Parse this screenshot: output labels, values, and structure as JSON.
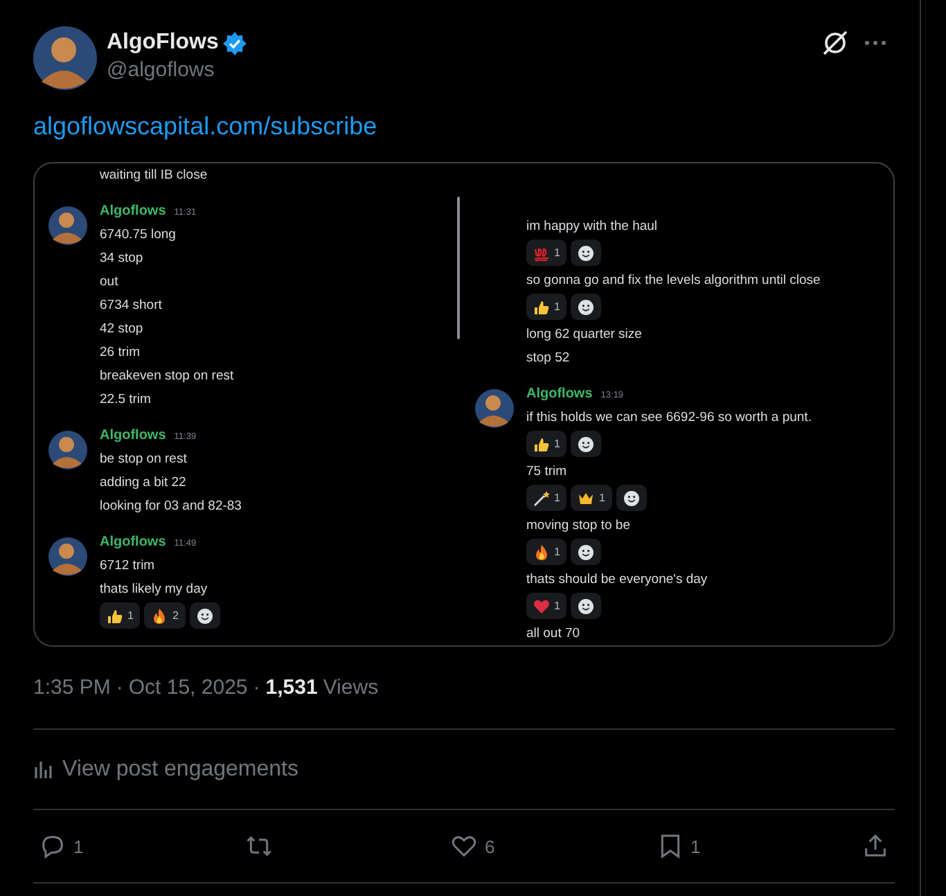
{
  "post": {
    "display_name": "AlgoFlows",
    "verified": true,
    "handle": "@algoflows",
    "link": "algoflowscapital.com/subscribe"
  },
  "chat_columns": [
    {
      "groups": [
        {
          "lines": [
            {
              "text": "waiting till IB close"
            }
          ]
        },
        {
          "author": "Algoflows",
          "time": "11:31",
          "lines": [
            {
              "text": "6740.75 long"
            },
            {
              "text": "34 stop"
            },
            {
              "text": "out"
            },
            {
              "text": "6734 short"
            },
            {
              "text": "42 stop"
            },
            {
              "text": "26 trim"
            },
            {
              "text": "breakeven stop on rest"
            },
            {
              "text": "22.5 trim"
            }
          ]
        },
        {
          "author": "Algoflows",
          "time": "11:39",
          "lines": [
            {
              "text": "be stop on rest"
            },
            {
              "text": "adding a bit 22"
            },
            {
              "text": "looking for 03 and 82-83"
            }
          ]
        },
        {
          "author": "Algoflows",
          "time": "11:49",
          "lines": [
            {
              "text": "6712 trim"
            },
            {
              "text": "thats likely my day",
              "reactions": [
                {
                  "kind": "thumbs_up",
                  "count": "1"
                },
                {
                  "kind": "fire",
                  "count": "2"
                }
              ],
              "add_reaction": true
            }
          ]
        }
      ]
    },
    {
      "groups": [
        {
          "lines": [
            {
              "text": "im happy with the haul",
              "reactions": [
                {
                  "kind": "hundred",
                  "count": "1"
                }
              ],
              "add_reaction": true
            },
            {
              "text": "so gonna go and fix the levels algorithm until close",
              "reactions": [
                {
                  "kind": "thumbs_up",
                  "count": "1"
                }
              ],
              "add_reaction": true
            },
            {
              "text": "long 62 quarter size"
            },
            {
              "text": "stop 52"
            }
          ]
        },
        {
          "author": "Algoflows",
          "time": "13:19",
          "lines": [
            {
              "text": "if this holds we can see 6692-96 so worth a punt.",
              "reactions": [
                {
                  "kind": "thumbs_up",
                  "count": "1"
                }
              ],
              "add_reaction": true
            },
            {
              "text": "75 trim",
              "reactions": [
                {
                  "kind": "wand",
                  "count": "1"
                },
                {
                  "kind": "crown",
                  "count": "1"
                }
              ],
              "add_reaction": true
            },
            {
              "text": "moving stop to be",
              "reactions": [
                {
                  "kind": "fire",
                  "count": "1"
                }
              ],
              "add_reaction": true
            },
            {
              "text": "thats should be everyone's day",
              "reactions": [
                {
                  "kind": "heart",
                  "count": "1"
                }
              ],
              "add_reaction": true
            },
            {
              "text": "all out 70"
            }
          ]
        }
      ]
    }
  ],
  "meta": {
    "time": "1:35 PM",
    "separator_1": "·",
    "date": "Oct 15, 2025",
    "separator_2": "·",
    "views_count": "1,531",
    "views_label": "Views"
  },
  "engagements": "View post engagements",
  "actions": [
    {
      "kind": "reply",
      "count": "1"
    },
    {
      "kind": "repost"
    },
    {
      "kind": "like",
      "count": "6"
    },
    {
      "kind": "bookmark",
      "count": "1"
    },
    {
      "kind": "share"
    }
  ]
}
